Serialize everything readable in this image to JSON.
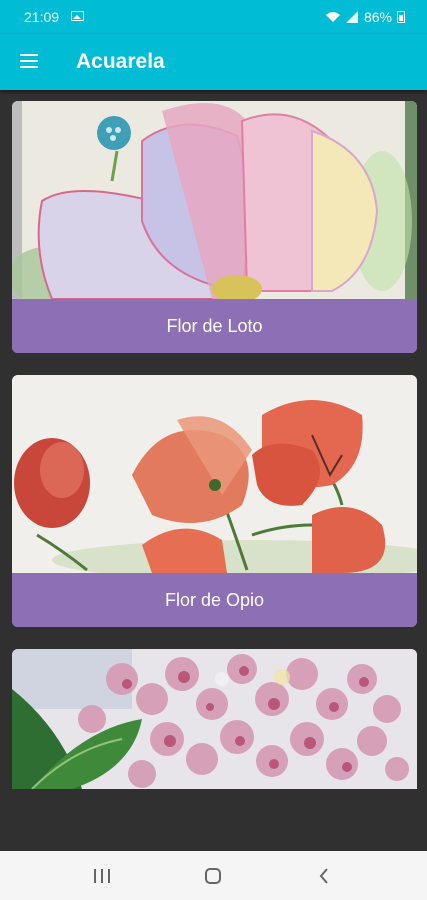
{
  "status_bar": {
    "time": "21:09",
    "battery": "86%"
  },
  "app_bar": {
    "title": "Acuarela"
  },
  "cards": [
    {
      "label": "Flor de Loto"
    },
    {
      "label": "Flor de Opio"
    },
    {
      "label": ""
    }
  ],
  "colors": {
    "app_bar": "#00bcd4",
    "card_label": "#8d6fb6",
    "background": "#303030"
  }
}
